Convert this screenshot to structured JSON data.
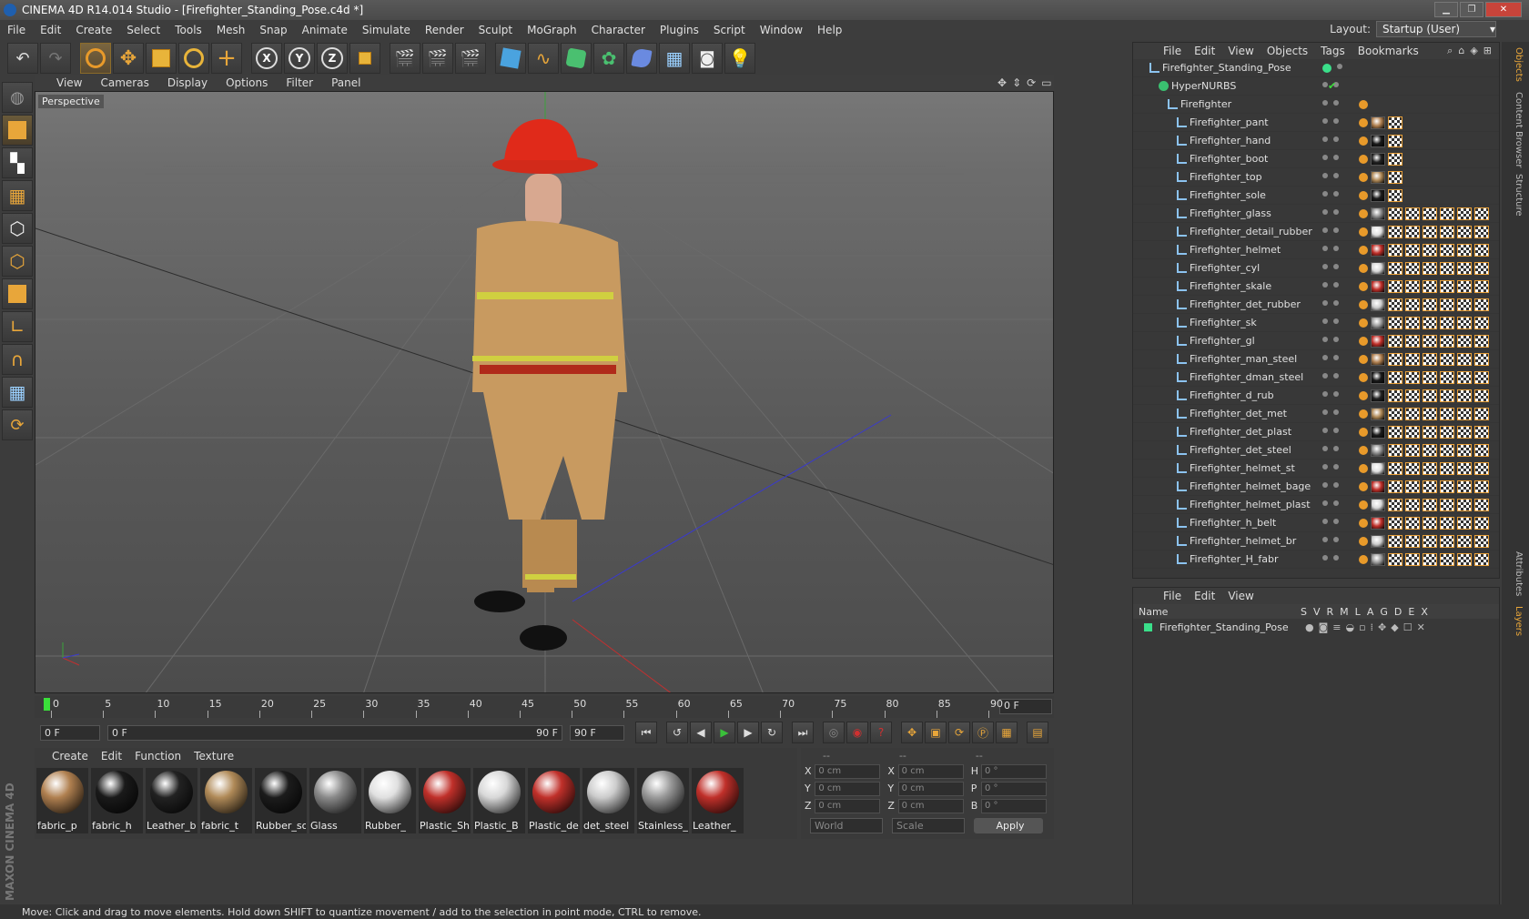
{
  "window": {
    "title": "CINEMA 4D R14.014 Studio - [Firefighter_Standing_Pose.c4d *]"
  },
  "menu": [
    "File",
    "Edit",
    "Create",
    "Select",
    "Tools",
    "Mesh",
    "Snap",
    "Animate",
    "Simulate",
    "Render",
    "Sculpt",
    "MoGraph",
    "Character",
    "Plugins",
    "Script",
    "Window",
    "Help"
  ],
  "layout": {
    "label": "Layout:",
    "value": "Startup (User)"
  },
  "viewport": {
    "menu": [
      "View",
      "Cameras",
      "Display",
      "Options",
      "Filter",
      "Panel"
    ],
    "label": "Perspective"
  },
  "timeline": {
    "ticks": [
      "0",
      "5",
      "10",
      "15",
      "20",
      "25",
      "30",
      "35",
      "40",
      "45",
      "50",
      "55",
      "60",
      "65",
      "70",
      "75",
      "80",
      "85",
      "90"
    ],
    "current_frame": "0 F"
  },
  "transport": {
    "start": "0 F",
    "range_start": "0 F",
    "range_end": "90 F",
    "end": "90 F"
  },
  "materials": {
    "menu": [
      "Create",
      "Edit",
      "Function",
      "Texture"
    ],
    "items": [
      {
        "label": "fabric_p",
        "color": "#b08050"
      },
      {
        "label": "fabric_h",
        "color": "#1a1a1a"
      },
      {
        "label": "Leather_bo",
        "color": "#222222"
      },
      {
        "label": "fabric_t",
        "color": "#b08a58"
      },
      {
        "label": "Rubber_so",
        "color": "#1c1c1c"
      },
      {
        "label": "Glass",
        "color": "#8a8a8a"
      },
      {
        "label": "Rubber_",
        "color": "#e0e0e0"
      },
      {
        "label": "Plastic_Shir",
        "color": "#c0302a"
      },
      {
        "label": "Plastic_B",
        "color": "#d8d8d8"
      },
      {
        "label": "Plastic_det",
        "color": "#c0302a"
      },
      {
        "label": "det_steel",
        "color": "#cccccc"
      },
      {
        "label": "Stainless_d",
        "color": "#9a9a9a"
      },
      {
        "label": "Leather_",
        "color": "#c0302a"
      }
    ]
  },
  "coords": {
    "headers": [
      "--",
      "--",
      "--"
    ],
    "rows": [
      {
        "a": "X",
        "av": "0 cm",
        "b": "X",
        "bv": "0 cm",
        "c": "H",
        "cv": "0 °"
      },
      {
        "a": "Y",
        "av": "0 cm",
        "b": "Y",
        "bv": "0 cm",
        "c": "P",
        "cv": "0 °"
      },
      {
        "a": "Z",
        "av": "0 cm",
        "b": "Z",
        "bv": "0 cm",
        "c": "B",
        "cv": "0 °"
      }
    ],
    "mode1": "World",
    "mode2": "Scale",
    "apply": "Apply"
  },
  "objects": {
    "menu": [
      "File",
      "Edit",
      "View",
      "Objects",
      "Tags",
      "Bookmarks"
    ],
    "root": "Firefighter_Standing_Pose",
    "hypernurbs": "HyperNURBS",
    "group": "Firefighter",
    "items": [
      "Firefighter_pant",
      "Firefighter_hand",
      "Firefighter_boot",
      "Firefighter_top",
      "Firefighter_sole",
      "Firefighter_glass",
      "Firefighter_detail_rubber",
      "Firefighter_helmet",
      "Firefighter_cyl",
      "Firefighter_skale",
      "Firefighter_det_rubber",
      "Firefighter_sk",
      "Firefighter_gl",
      "Firefighter_man_steel",
      "Firefighter_dman_steel",
      "Firefighter_d_rub",
      "Firefighter_det_met",
      "Firefighter_det_plast",
      "Firefighter_det_steel",
      "Firefighter_helmet_st",
      "Firefighter_helmet_bage",
      "Firefighter_helmet_plast",
      "Firefighter_h_belt",
      "Firefighter_helmet_br",
      "Firefighter_H_fabr"
    ]
  },
  "layers": {
    "menu": [
      "File",
      "Edit",
      "View"
    ],
    "name_header": "Name",
    "cols": [
      "S",
      "V",
      "R",
      "M",
      "L",
      "A",
      "G",
      "D",
      "E",
      "X"
    ],
    "row": "Firefighter_Standing_Pose"
  },
  "sidetabs": [
    "Objects",
    "Content Browser",
    "Structure",
    "Attributes",
    "Layers"
  ],
  "status": "Move: Click and drag to move elements. Hold down SHIFT to quantize movement / add to the selection in point mode, CTRL to remove.",
  "brand": "MAXON CINEMA 4D"
}
